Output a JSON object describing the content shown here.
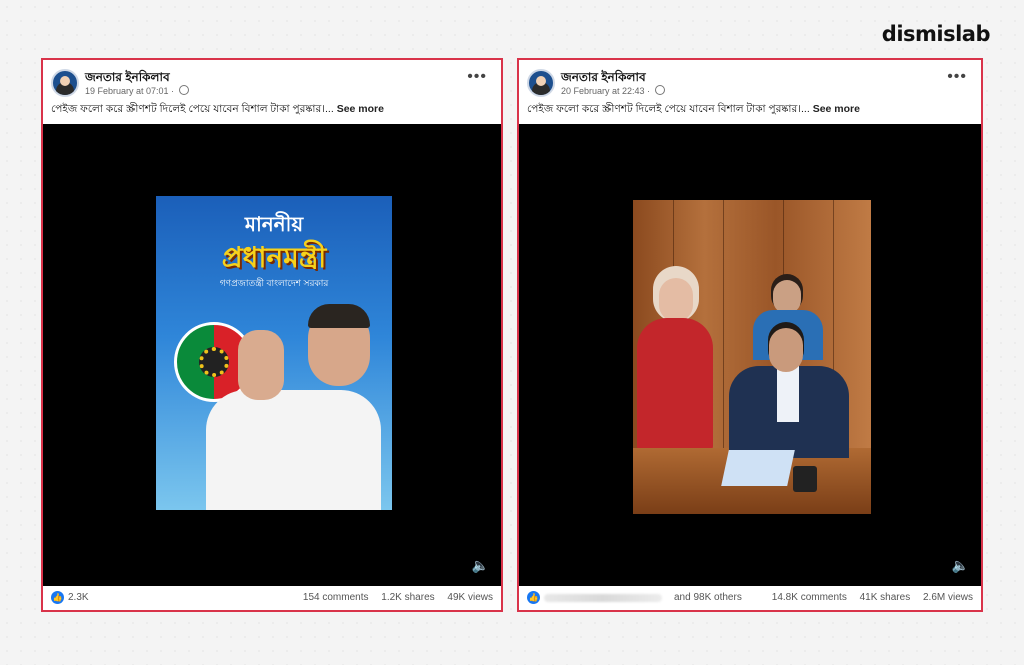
{
  "brand": "dismislab",
  "posts": [
    {
      "page_name": "জনতার ইনকিলাব",
      "date": "19 February at 07:01 ·",
      "caption": "পেইজ ফলো করে স্ক্রীণশট দিলেই পেয়ে যাবেন বিশাল টাকা পুরষ্কার।...",
      "see_more": "See more",
      "thumb_title1": "মাননীয়",
      "thumb_title2": "প্রধানমন্ত্রী",
      "thumb_sub": "গণপ্রজাতন্ত্রী বাংলাদেশ সরকার",
      "likes": "2.3K",
      "comments": "154 comments",
      "shares": "1.2K shares",
      "views": "49K views"
    },
    {
      "page_name": "জনতার ইনকিলাব",
      "date": "20 February at 22:43 ·",
      "caption": "পেইজ ফলো করে স্ক্রীণশট দিলেই পেয়ে যাবেন বিশাল টাকা পুরষ্কার।...",
      "see_more": "See more",
      "others": "and 98K others",
      "comments": "14.8K comments",
      "shares": "41K shares",
      "views": "2.6M views"
    }
  ],
  "icons": {
    "more": "more-dots-icon",
    "mute": "mute-icon",
    "like": "like-icon",
    "globe": "globe-icon"
  }
}
